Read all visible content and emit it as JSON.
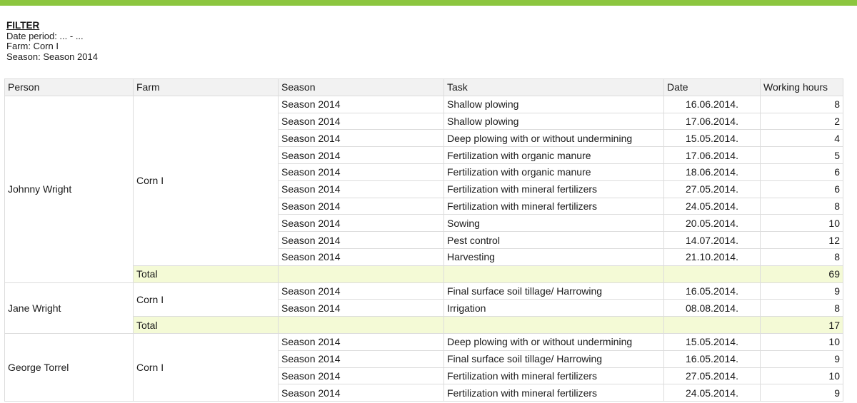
{
  "filter": {
    "title": "FILTER",
    "date_period": "Date period: ... - ...",
    "farm": "Farm: Corn I",
    "season": "Season: Season 2014"
  },
  "table": {
    "headers": [
      "Person",
      "Farm",
      "Season",
      "Task",
      "Date",
      "Working hours"
    ],
    "total_label": "Total",
    "groups": [
      {
        "person": "Johnny Wright",
        "farm": "Corn I",
        "rows": [
          [
            "Season 2014",
            "Shallow plowing",
            "16.06.2014.",
            "8"
          ],
          [
            "Season 2014",
            "Shallow plowing",
            "17.06.2014.",
            "2"
          ],
          [
            "Season 2014",
            "Deep plowing with or without undermining",
            "15.05.2014.",
            "4"
          ],
          [
            "Season 2014",
            "Fertilization with organic manure",
            "17.06.2014.",
            "5"
          ],
          [
            "Season 2014",
            "Fertilization with organic manure",
            "18.06.2014.",
            "6"
          ],
          [
            "Season 2014",
            "Fertilization with mineral fertilizers",
            "27.05.2014.",
            "6"
          ],
          [
            "Season 2014",
            "Fertilization with mineral fertilizers",
            "24.05.2014.",
            "8"
          ],
          [
            "Season 2014",
            "Sowing",
            "20.05.2014.",
            "10"
          ],
          [
            "Season 2014",
            "Pest control",
            "14.07.2014.",
            "12"
          ],
          [
            "Season 2014",
            "Harvesting",
            "21.10.2014.",
            "8"
          ]
        ],
        "total": "69"
      },
      {
        "person": "Jane Wright",
        "farm": "Corn I",
        "rows": [
          [
            "Season 2014",
            "Final surface soil tillage/ Harrowing",
            "16.05.2014.",
            "9"
          ],
          [
            "Season 2014",
            "Irrigation",
            "08.08.2014.",
            "8"
          ]
        ],
        "total": "17"
      },
      {
        "person": "George Torrel",
        "farm": "Corn I",
        "rows": [
          [
            "Season 2014",
            "Deep plowing with or without undermining",
            "15.05.2014.",
            "10"
          ],
          [
            "Season 2014",
            "Final surface soil tillage/ Harrowing",
            "16.05.2014.",
            "9"
          ],
          [
            "Season 2014",
            "Fertilization with mineral fertilizers",
            "27.05.2014.",
            "10"
          ],
          [
            "Season 2014",
            "Fertilization with mineral fertilizers",
            "24.05.2014.",
            "9"
          ]
        ]
      }
    ]
  },
  "colors": {
    "accent_bar": "#8cc63f",
    "total_row": "#f4fad6",
    "header_row": "#f2f2f2",
    "border": "#dcdcdc"
  }
}
